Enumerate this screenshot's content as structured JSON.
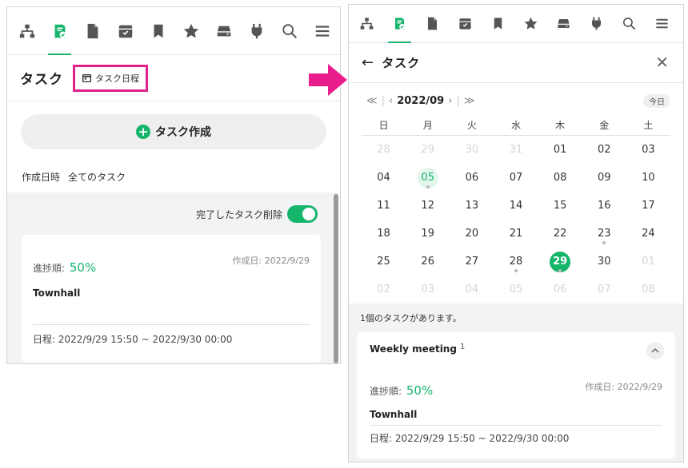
{
  "colors": {
    "accent": "#16b56c",
    "highlight": "#e0218a"
  },
  "toolbar_icons": [
    "sitemap-icon",
    "task-icon",
    "document-icon",
    "archive-icon",
    "bookmark-icon",
    "star-icon",
    "drive-icon",
    "plug-icon",
    "search-icon",
    "menu-icon"
  ],
  "left": {
    "title": "タスク",
    "schedule_button": "タスク日程",
    "create_button": "タスク作成",
    "filter_sort": "作成日時",
    "filter_scope": "全てのタスク",
    "delete_completed_label": "完了したタスク削除",
    "card": {
      "created": "作成日: 2022/9/29",
      "progress_label": "進捗順:",
      "progress_value": "50%",
      "name": "Townhall",
      "schedule": "日程: 2022/9/29 15:50 ~ 2022/9/30 00:00"
    }
  },
  "right": {
    "back": "←",
    "title": "タスク",
    "close": "✕",
    "nav": {
      "prev_year": "≪",
      "prev_month": "‹",
      "month": "2022/09",
      "next_month": "›",
      "next_year": "≫",
      "sep": "|"
    },
    "today_button": "今日",
    "weekdays": [
      "日",
      "月",
      "火",
      "水",
      "木",
      "金",
      "土"
    ],
    "weeks": [
      [
        "28",
        "29",
        "30",
        "31",
        "01",
        "02",
        "03"
      ],
      [
        "04",
        "05",
        "06",
        "07",
        "08",
        "09",
        "10"
      ],
      [
        "11",
        "12",
        "13",
        "14",
        "15",
        "16",
        "17"
      ],
      [
        "18",
        "19",
        "20",
        "21",
        "22",
        "23",
        "24"
      ],
      [
        "25",
        "26",
        "27",
        "28",
        "29",
        "30",
        "01"
      ],
      [
        "02",
        "03",
        "04",
        "05",
        "06",
        "07",
        "08"
      ]
    ],
    "task_count": "1個のタスクがあります。",
    "group": {
      "name": "Weekly meeting",
      "count": "1",
      "card": {
        "created": "作成日: 2022/9/29",
        "progress_label": "進捗順:",
        "progress_value": "50%",
        "name": "Townhall",
        "schedule": "日程: 2022/9/29 15:50 ~ 2022/9/30 00:00"
      }
    }
  }
}
